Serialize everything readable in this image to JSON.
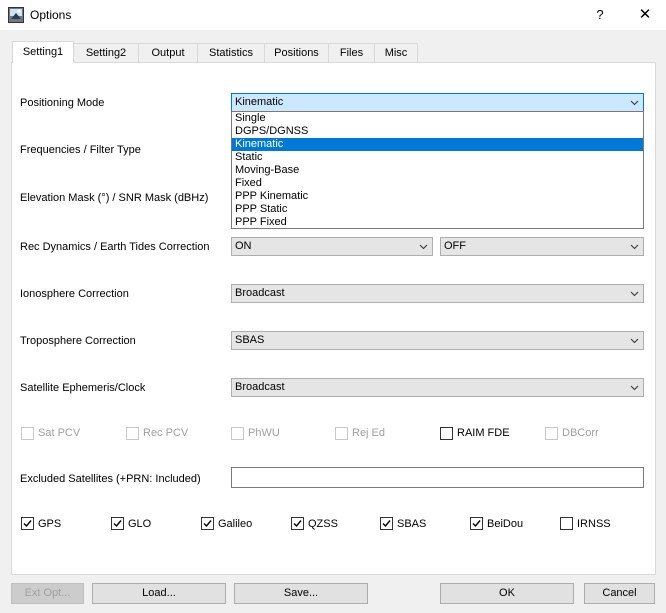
{
  "window": {
    "title": "Options",
    "help_symbol": "?",
    "close_symbol": "✕",
    "icon": "rtk-app-icon"
  },
  "tabs": [
    "Setting1",
    "Setting2",
    "Output",
    "Statistics",
    "Positions",
    "Files",
    "Misc"
  ],
  "active_tab": "Setting1",
  "rows": {
    "positioning_mode": {
      "label": "Positioning Mode",
      "value": "Kinematic"
    },
    "frequencies": {
      "label": "Frequencies / Filter Type"
    },
    "elevation": {
      "label": "Elevation Mask (°) / SNR Mask (dBHz)"
    },
    "rec_dynamics": {
      "label": "Rec Dynamics / Earth Tides Correction",
      "value1": "ON",
      "value2": "OFF"
    },
    "ionosphere": {
      "label": "Ionosphere Correction",
      "value": "Broadcast"
    },
    "troposphere": {
      "label": "Troposphere Correction",
      "value": "SBAS"
    },
    "ephemeris": {
      "label": "Satellite Ephemeris/Clock",
      "value": "Broadcast"
    },
    "excluded": {
      "label": "Excluded Satellites (+PRN: Included)",
      "value": ""
    }
  },
  "dropdown_options": [
    "Single",
    "DGPS/DGNSS",
    "Kinematic",
    "Static",
    "Moving-Base",
    "Fixed",
    "PPP Kinematic",
    "PPP Static",
    "PPP Fixed"
  ],
  "dropdown_selected": "Kinematic",
  "options_checks": [
    {
      "label": "Sat PCV",
      "checked": false,
      "enabled": false
    },
    {
      "label": "Rec PCV",
      "checked": false,
      "enabled": false
    },
    {
      "label": "PhWU",
      "checked": false,
      "enabled": false
    },
    {
      "label": "Rej Ed",
      "checked": false,
      "enabled": false
    },
    {
      "label": "RAIM FDE",
      "checked": false,
      "enabled": true
    },
    {
      "label": "DBCorr",
      "checked": false,
      "enabled": false
    }
  ],
  "systems": [
    {
      "label": "GPS",
      "checked": true
    },
    {
      "label": "GLO",
      "checked": true
    },
    {
      "label": "Galileo",
      "checked": true
    },
    {
      "label": "QZSS",
      "checked": true
    },
    {
      "label": "SBAS",
      "checked": true
    },
    {
      "label": "BeiDou",
      "checked": true
    },
    {
      "label": "IRNSS",
      "checked": false
    }
  ],
  "buttons": {
    "ext_opt": "Ext Opt...",
    "load": "Load...",
    "save": "Save...",
    "ok": "OK",
    "cancel": "Cancel"
  },
  "colors": {
    "selection": "#0078d7",
    "focus_fill": "#cce8ff"
  }
}
